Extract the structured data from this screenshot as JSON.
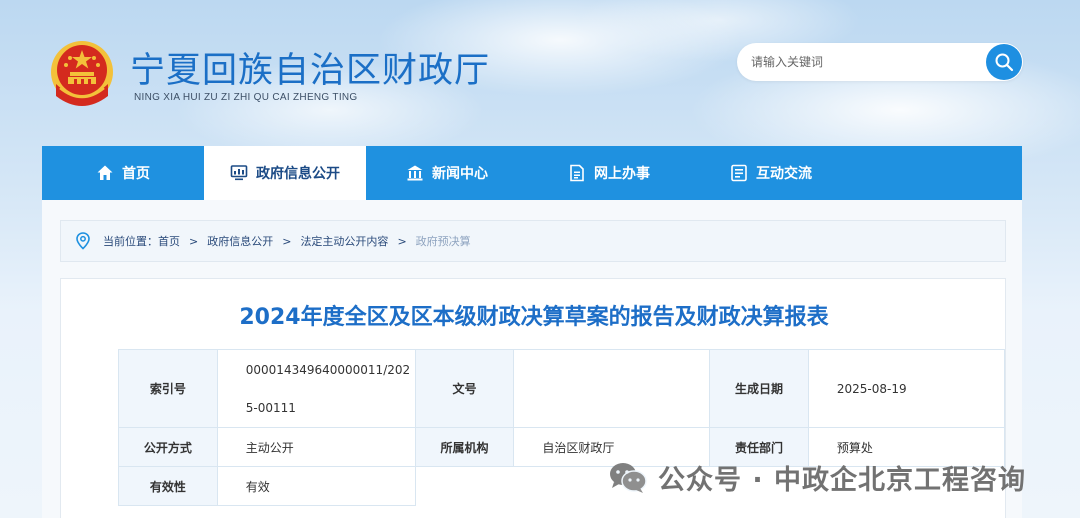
{
  "header": {
    "site_title": "宁夏回族自治区财政厅",
    "site_pinyin": "NING XIA HUI ZU ZI ZHI QU CAI ZHENG TING",
    "search_placeholder": "请输入关键词"
  },
  "nav": {
    "items": [
      {
        "label": "首页",
        "icon": "home-icon"
      },
      {
        "label": "政府信息公开",
        "icon": "monitor-icon",
        "active": true
      },
      {
        "label": "新闻中心",
        "icon": "bank-icon"
      },
      {
        "label": "网上办事",
        "icon": "document-icon"
      },
      {
        "label": "互动交流",
        "icon": "list-icon"
      }
    ]
  },
  "breadcrumb": {
    "prefix": "当前位置：",
    "items": [
      "首页",
      "政府信息公开",
      "法定主动公开内容",
      "政府预决算"
    ],
    "separator": ">"
  },
  "article": {
    "title": "2024年度全区及区本级财政决算草案的报告及财政决算报表",
    "meta": {
      "index_label": "索引号",
      "index_value": "000014349640000011/2025-00111",
      "doc_no_label": "文号",
      "doc_no_value": "",
      "date_label": "生成日期",
      "date_value": "2025-08-19",
      "publish_label": "公开方式",
      "publish_value": "主动公开",
      "org_label": "所属机构",
      "org_value": "自治区财政厅",
      "dept_label": "责任部门",
      "dept_value": "预算处",
      "valid_label": "有效性",
      "valid_value": "有效"
    }
  },
  "watermark": {
    "text": "公众号 · 中政企北京工程咨询"
  },
  "colors": {
    "brand_blue": "#1f91e0",
    "title_blue": "#1d6ec7",
    "emblem_red": "#d42a1e",
    "emblem_gold": "#f3c13a"
  }
}
